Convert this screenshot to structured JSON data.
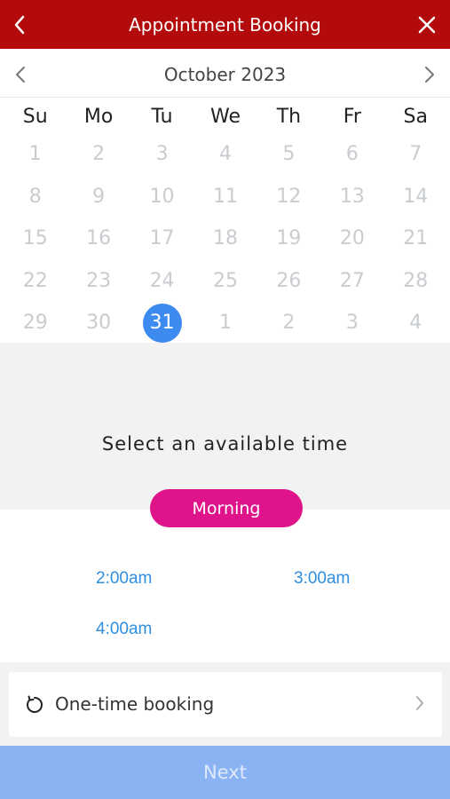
{
  "header": {
    "title": "Appointment Booking",
    "bg_color": "#b30b0b",
    "back_icon": "chevron-left-icon",
    "close_icon": "close-icon"
  },
  "calendar": {
    "month_label": "October 2023",
    "weekdays": [
      "Su",
      "Mo",
      "Tu",
      "We",
      "Th",
      "Fr",
      "Sa"
    ],
    "weeks": [
      [
        "1",
        "2",
        "3",
        "4",
        "5",
        "6",
        "7"
      ],
      [
        "8",
        "9",
        "10",
        "11",
        "12",
        "13",
        "14"
      ],
      [
        "15",
        "16",
        "17",
        "18",
        "19",
        "20",
        "21"
      ],
      [
        "22",
        "23",
        "24",
        "25",
        "26",
        "27",
        "28"
      ],
      [
        "29",
        "30",
        "31",
        "1",
        "2",
        "3",
        "4"
      ]
    ],
    "selected_day": "31",
    "selected_color": "#3d8bf0"
  },
  "time_section": {
    "heading": "Select an available time",
    "period_label": "Morning",
    "period_color": "#e0148a",
    "slots": [
      "2:00am",
      "3:00am",
      "4:00am"
    ]
  },
  "booking": {
    "label": "One-time booking",
    "icon": "refresh-icon"
  },
  "footer": {
    "next_label": "Next",
    "next_color": "#8ab3f3"
  }
}
